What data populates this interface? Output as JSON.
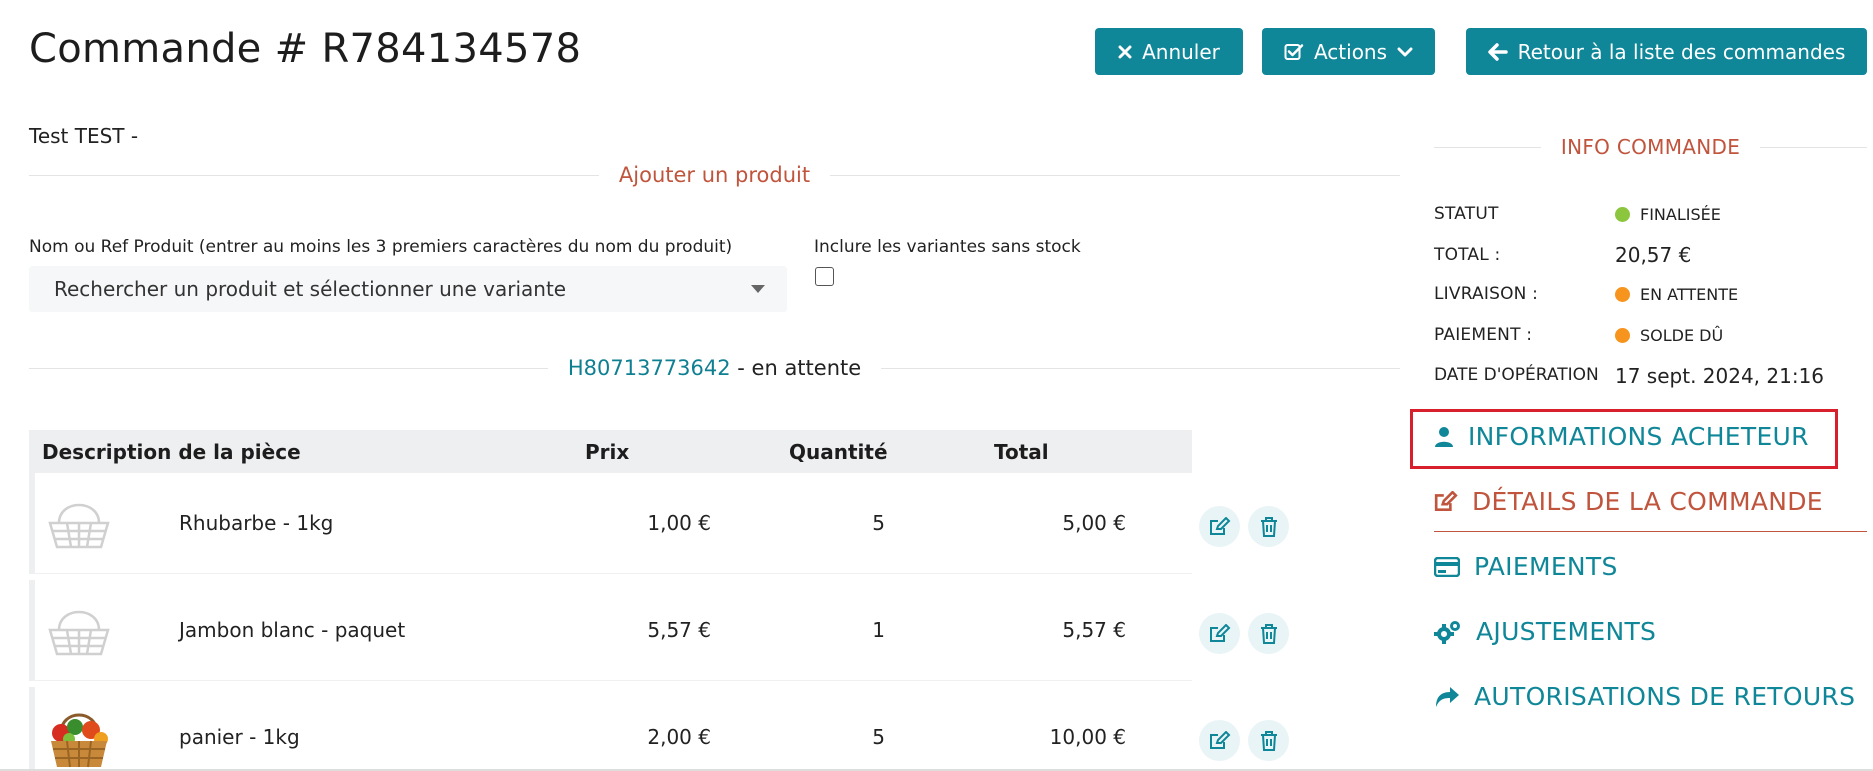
{
  "header": {
    "title": "Commande # R784134578",
    "cancel_label": "Annuler",
    "actions_label": "Actions",
    "back_label": "Retour à la liste des commandes"
  },
  "customer": "Test TEST -",
  "add_product": {
    "title": "Ajouter un produit",
    "search_label": "Nom ou Ref Produit (entrer au moins les 3 premiers caractères du nom du produit)",
    "search_placeholder": "Rechercher un produit et sélectionner une variante",
    "variant_label": "Inclure les variantes sans stock",
    "include_out_of_stock": false
  },
  "shipment": {
    "number": "H80713773642",
    "state": " - en attente"
  },
  "table": {
    "headers": {
      "description": "Description de la pièce",
      "price": "Prix",
      "quantity": "Quantité",
      "total": "Total"
    },
    "rows": [
      {
        "name": "Rhubarbe - 1kg",
        "price": "1,00 €",
        "quantity": "5",
        "total": "5,00 €",
        "image": "basket-placeholder-icon"
      },
      {
        "name": "Jambon blanc - paquet",
        "price": "5,57 €",
        "quantity": "1",
        "total": "5,57 €",
        "image": "basket-placeholder-icon"
      },
      {
        "name": "panier - 1kg",
        "price": "2,00 €",
        "quantity": "5",
        "total": "10,00 €",
        "image": "vegetable-basket-photo"
      }
    ]
  },
  "order_info": {
    "title": "INFO COMMANDE",
    "status_label": "STATUT",
    "status_value": "FINALISÉE",
    "status_color": "#8cc63f",
    "total_label": "TOTAL :",
    "total_value": "20,57 €",
    "shipping_label": "LIVRAISON :",
    "shipping_value": "EN ATTENTE",
    "shipping_color": "#f7941d",
    "payment_label": "PAIEMENT :",
    "payment_value": "SOLDE DÛ",
    "payment_color": "#f7941d",
    "date_label": "DATE D'OPÉRATION",
    "date_value": "17 sept. 2024, 21:16"
  },
  "nav": {
    "customer_info": "INFORMATIONS ACHETEUR",
    "order_details": "DÉTAILS DE LA COMMANDE",
    "payments": "PAIEMENTS",
    "adjustments": "AJUSTEMENTS",
    "return_authorizations": "AUTORISATIONS DE RETOURS"
  },
  "colors": {
    "primary": "#0f8798",
    "accent": "#c0543c",
    "highlight": "#d8202c"
  }
}
